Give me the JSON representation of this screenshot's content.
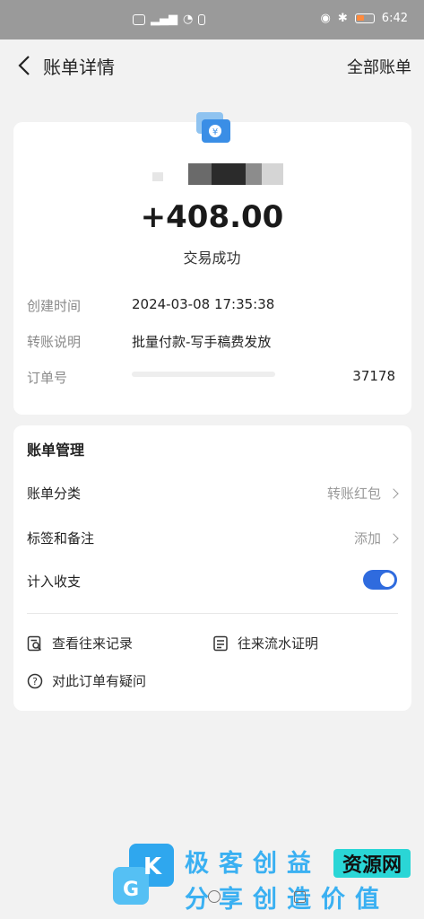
{
  "status_bar": {
    "time": "6:42"
  },
  "header": {
    "title": "账单详情",
    "right_link": "全部账单"
  },
  "transaction": {
    "amount": "+408.00",
    "status": "交易成功",
    "rows": [
      {
        "label": "创建时间",
        "value": "2024-03-08 17:35:38"
      },
      {
        "label": "转账说明",
        "value": "批量付款-写手稿费发放"
      },
      {
        "label": "订单号",
        "value": "37178"
      }
    ]
  },
  "management": {
    "title": "账单管理",
    "category": {
      "label": "账单分类",
      "value": "转账红包"
    },
    "tags": {
      "label": "标签和备注",
      "value": "添加"
    },
    "income": {
      "label": "计入收支",
      "enabled": true
    },
    "links": {
      "records": "查看往来记录",
      "proof": "往来流水证明",
      "question": "对此订单有疑问"
    }
  },
  "watermark": {
    "line1": "极客创益",
    "badge": "资源网",
    "line2": "分享创造价值",
    "logo_letters": [
      "K",
      "G"
    ]
  },
  "colors": {
    "accent": "#2f6bde",
    "watermark": "#3ab0f2",
    "badge": "#2ad6d6"
  }
}
